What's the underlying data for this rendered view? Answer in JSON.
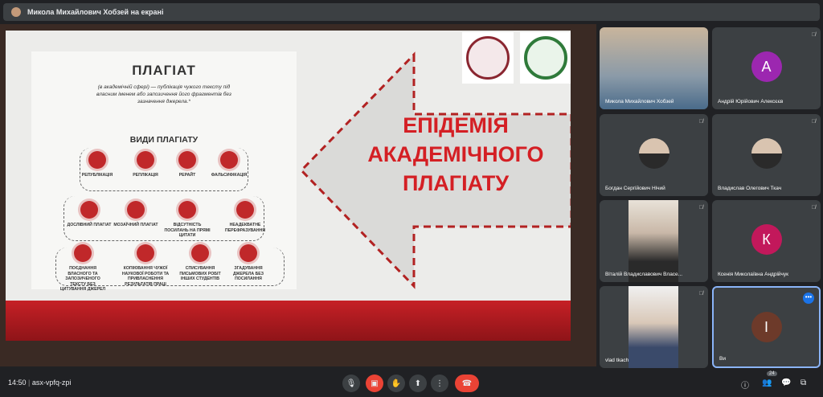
{
  "banner": {
    "presenter_text": "Микола Михайлович Хобзей на екрані"
  },
  "slide": {
    "title_lines": [
      "ЕПІДЕМІЯ",
      "АКАДЕМІЧНОГО",
      "ПЛАГІАТУ"
    ],
    "poster": {
      "title": "ПЛАГІАТ",
      "definition": "(в академічній сфері) — публікація чужого тексту під власним іменем або запозичення його фрагментів без зазначення джерела.*",
      "subtitle": "ВИДИ ПЛАГІАТУ",
      "types": [
        "РЕПУБЛІКАЦІЯ",
        "РЕПЛІКАЦІЯ",
        "РЕРАЙТ",
        "ФАЛЬСИФІКАЦІЯ",
        "ДОСЛІВНИЙ ПЛАГІАТ",
        "МОЗАЇЧНИЙ ПЛАГІАТ",
        "ВІДСУТНІСТЬ ПОСИЛАНЬ НА ПРЯМІ ЦИТАТИ",
        "НЕАДЕКВАТНЕ ПЕРЕФРАЗУВАННЯ",
        "ПОЄДНАННЯ ВЛАСНОГО ТА ЗАПОЗИЧЕНОГО ТЕКСТУ БЕЗ ЦИТУВАННЯ ДЖЕРЕЛ",
        "КОПІЮВАННЯ ЧУЖОЇ НАУКОВОЇ РОБОТИ ТА ПРИВЛАСНЕННЯ РЕЗУЛЬТАТІВ ПРАЦІ",
        "СПИСУВАННЯ ПИСЬМОВИХ РОБІТ ІНШИХ СТУДЕНТІВ",
        "ЗГАДУВАННЯ ДЖЕРЕЛА БЕЗ ПОСИЛАННЯ"
      ]
    }
  },
  "participants": [
    {
      "name": "Микола Михайлович Хобзей"
    },
    {
      "name": "Андрій Юрійович Алексєєв",
      "letter": "А",
      "color": "#9c27b0"
    },
    {
      "name": "Богдан Сергійович Нічий"
    },
    {
      "name": "Владислав Олегович Ткач"
    },
    {
      "name": "Віталій Владиславович Власе..."
    },
    {
      "name": "Ксенія Миколаївна Андрійчук",
      "letter": "К",
      "color": "#c2185b"
    },
    {
      "name": "vlad tkach"
    },
    {
      "name": "Ви",
      "letter": "І",
      "color": "#6d3a2a"
    }
  ],
  "bottom": {
    "time": "14:50",
    "separator": "|",
    "meeting_code": "asx-vpfq-zpi",
    "people_count": "24",
    "icons": [
      "mic-icon",
      "camera-off-icon",
      "raise-hand-icon",
      "present-icon",
      "more-icon",
      "end-call-icon",
      "info-icon",
      "people-icon",
      "chat-icon",
      "activities-icon"
    ]
  }
}
